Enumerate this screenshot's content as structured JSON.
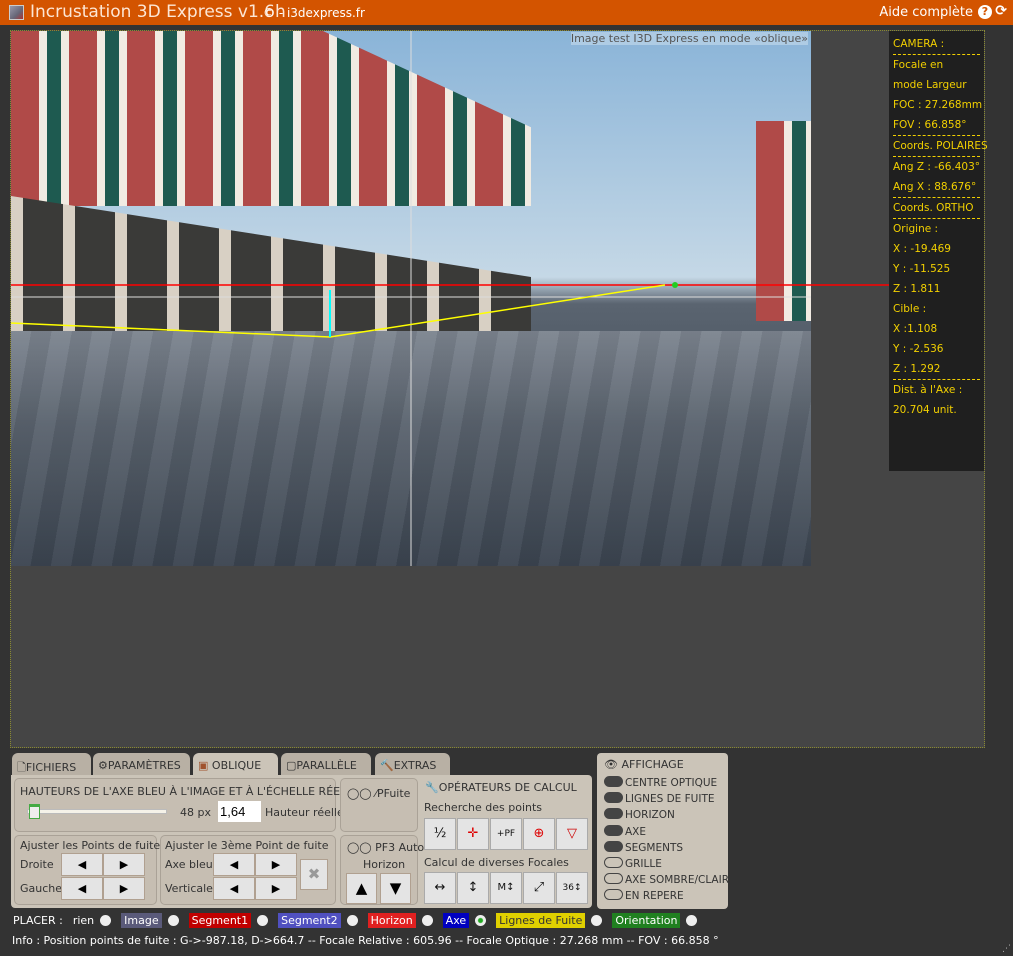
{
  "header": {
    "title": "Incrustation 3D Express v1.6h",
    "copyright": "© - i3dexpress.fr",
    "help": "Aide complète",
    "help_icon": "question-circle-icon",
    "refresh_icon": "refresh-icon",
    "color": "#d35400"
  },
  "image": {
    "caption": "Image test I3D Express en mode «oblique»"
  },
  "camera": {
    "lines": [
      "CAMERA :",
      "---",
      "Focale en",
      "mode Largeur",
      "FOC : 27.268mm",
      "FOV : 66.858°",
      "---",
      "Coords. POLAIRES",
      "---",
      "Ang Z : -66.403°",
      "Ang X : 88.676°",
      "---",
      "Coords. ORTHO",
      "---",
      "Origine :",
      "X : -19.469",
      "Y : -11.525",
      "Z : 1.811",
      "Cible :",
      "X :1.108",
      "Y : -2.536",
      "Z : 1.292",
      "---",
      "Dist. à l'Axe :",
      "20.704 unit."
    ]
  },
  "tabs": [
    {
      "label": "FICHIERS",
      "icon": "file-icon"
    },
    {
      "label": "PARAMÈTRES",
      "icon": "gear-icon"
    },
    {
      "label": "OBLIQUE",
      "icon": "cube-icon",
      "active": true
    },
    {
      "label": "PARALLÈLE",
      "icon": "square-icon"
    },
    {
      "label": "EXTRAS",
      "icon": "gavel-icon"
    }
  ],
  "oblique": {
    "heights_title": "HAUTEURS DE L'AXE BLEU À L'IMAGE ET À L'ÉCHELLE RÉELLE",
    "slider_value": "48 px",
    "real_height": "1,64",
    "real_height_label": "Hauteur réelle",
    "pfuite": "PFuite",
    "adjust_pf": "Ajuster les Points de fuite",
    "droite": "Droite",
    "gauche": "Gauche",
    "adjust_pf3": "Ajuster le 3ème Point de fuite",
    "axe_bleu": "Axe bleu",
    "verticale": "Verticale",
    "pf3_auto": "PF3 Auto",
    "horizon": "Horizon",
    "operators": "OPÉRATEURS DE CALCUL",
    "search_points": "Recherche des points",
    "focales": "Calcul de diverses Focales",
    "left": "◀",
    "right": "▶",
    "up": "▲",
    "down": "▼",
    "clear": "✖",
    "search_buttons": [
      "½",
      "✛",
      "+PF",
      "⊕",
      "▽"
    ],
    "focal_buttons": [
      "↔",
      "↕",
      "M↕",
      "⤢",
      "36↕"
    ]
  },
  "affichage": {
    "title": "AFFICHAGE",
    "items": [
      {
        "label": "CENTRE OPTIQUE",
        "on": true
      },
      {
        "label": "LIGNES DE FUITE",
        "on": true
      },
      {
        "label": "HORIZON",
        "on": true
      },
      {
        "label": "AXE",
        "on": true
      },
      {
        "label": "SEGMENTS",
        "on": true
      },
      {
        "label": "GRILLE",
        "on": false
      },
      {
        "label": "AXE SOMBRE/CLAIR",
        "on": false
      },
      {
        "label": "EN REPERE",
        "on": false
      }
    ]
  },
  "placer": {
    "label": "PLACER :",
    "options": [
      {
        "label": "rien",
        "color": ""
      },
      {
        "label": "Image",
        "color": "#5a5a7a"
      },
      {
        "label": "Segment1",
        "color": "#c00000"
      },
      {
        "label": "Segment2",
        "color": "#5050c0"
      },
      {
        "label": "Horizon",
        "color": "#e02020"
      },
      {
        "label": "Axe",
        "color": "#0000c0",
        "selected": true
      },
      {
        "label": "Lignes de Fuite",
        "color": "#e0d000",
        "dark": true
      },
      {
        "label": "Orientation",
        "color": "#208020"
      }
    ]
  },
  "info": "Info : Position points de fuite : G->-987.18, D->664.7 -- Focale Relative : 605.96 -- Focale Optique : 27.268 mm -- FOV : 66.858 °"
}
